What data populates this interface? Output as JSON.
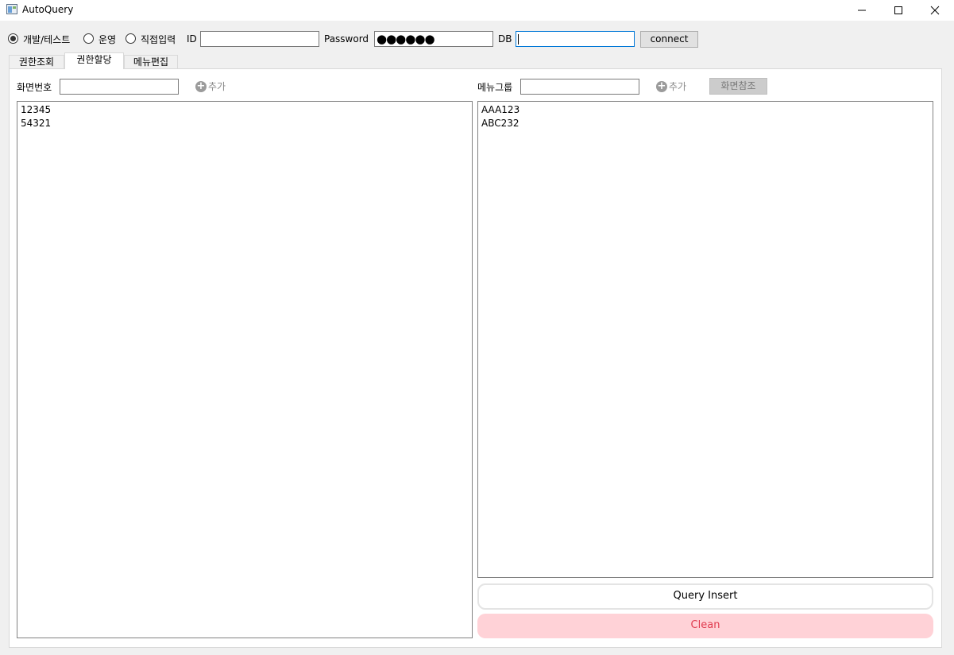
{
  "window": {
    "title": "AutoQuery",
    "minimize": "─",
    "maximize": "☐",
    "close": "✕"
  },
  "connection": {
    "env_options": [
      {
        "label": "개발/테스트",
        "checked": true
      },
      {
        "label": "운영",
        "checked": false
      },
      {
        "label": "직접입력",
        "checked": false
      }
    ],
    "id_label": "ID",
    "id_value": "",
    "password_label": "Password",
    "password_mask": "●●●●●●",
    "db_label": "DB",
    "db_value": "",
    "connect_label": "connect"
  },
  "tabs": [
    {
      "label": "권한조회",
      "active": false
    },
    {
      "label": "권한할당",
      "active": true
    },
    {
      "label": "메뉴편집",
      "active": false
    }
  ],
  "left_pane": {
    "label": "화면번호",
    "input_value": "",
    "add_label": "추가",
    "items": [
      "12345",
      "54321"
    ]
  },
  "right_pane": {
    "label": "메뉴그룹",
    "input_value": "",
    "add_label": "추가",
    "ref_label": "화면참조",
    "items": [
      "AAA123",
      "ABC232"
    ]
  },
  "actions": {
    "query_insert_label": "Query Insert",
    "clean_label": "Clean"
  },
  "colors": {
    "focus_border": "#0078d7",
    "clean_bg": "#ffd2d7",
    "clean_text": "#e03a4e"
  }
}
